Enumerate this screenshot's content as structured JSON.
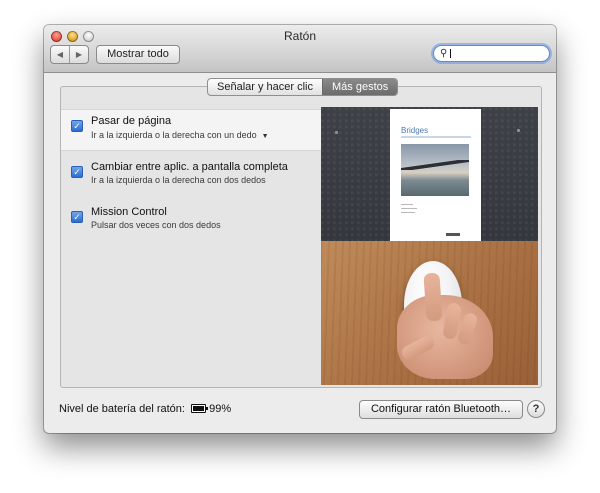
{
  "window": {
    "title": "Ratón",
    "nav_back": "◀",
    "nav_forward": "▶",
    "show_all_label": "Mostrar todo",
    "search": {
      "value": "",
      "icon": "search-icon"
    }
  },
  "tabs": [
    {
      "label": "Señalar y hacer clic",
      "active": false
    },
    {
      "label": "Más gestos",
      "active": true
    }
  ],
  "gestures": [
    {
      "title": "Pasar de página",
      "description": "Ir a la izquierda o la derecha con un dedo",
      "checked": true,
      "selected": true,
      "has_dropdown": true
    },
    {
      "title": "Cambiar entre aplic. a pantalla completa",
      "description": "Ir a la izquierda o la derecha con dos dedos",
      "checked": true,
      "selected": false
    },
    {
      "title": "Mission Control",
      "description": "Pulsar dos veces con dos dedos",
      "checked": true,
      "selected": false
    }
  ],
  "preview": {
    "document_title": "Bridges"
  },
  "footer": {
    "battery_label": "Nivel de batería del ratón:",
    "battery_value": "99%",
    "bluetooth_button": "Configurar ratón Bluetooth…",
    "help": "?"
  },
  "colors": {
    "accent": "#2d6cd1",
    "active_tab": "#6c6c6c"
  }
}
